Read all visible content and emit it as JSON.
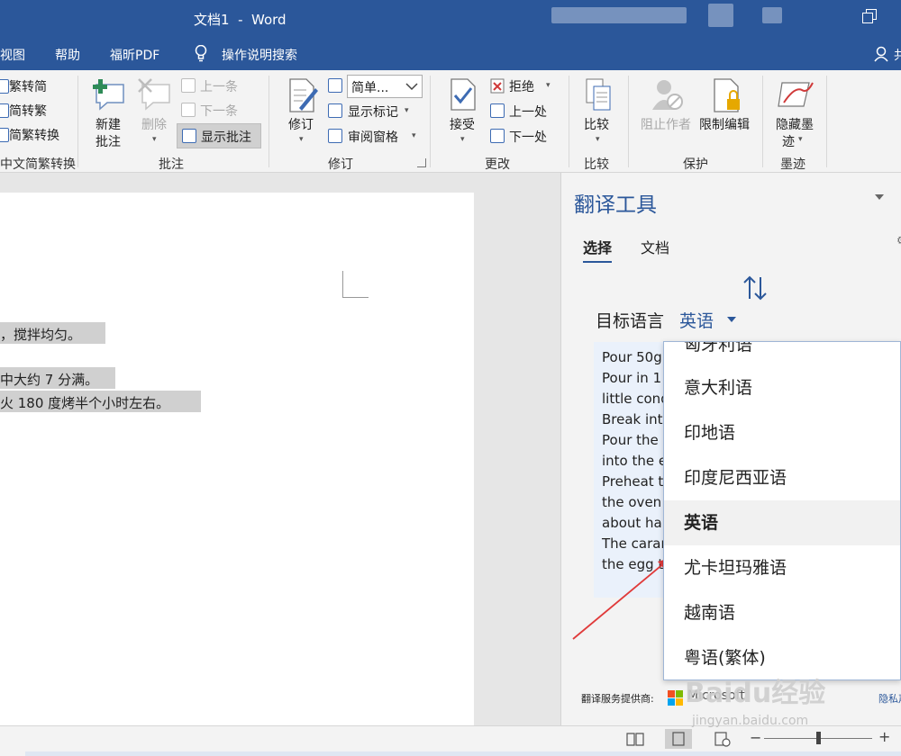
{
  "window": {
    "title": "文档1  -  Word"
  },
  "menu": {
    "items": [
      "视图",
      "帮助",
      "福昕PDF",
      "操作说明搜索"
    ],
    "user_initial": "共"
  },
  "ribbon": {
    "chinese_conversion": {
      "items": [
        "繁转简",
        "简转繁",
        "简繁转换"
      ],
      "group_label": "中文简繁转换"
    },
    "comments": {
      "new_comment": "新建批注",
      "new_comment_line1": "新建",
      "new_comment_line2": "批注",
      "delete": "删除",
      "previous": "上一条",
      "next": "下一条",
      "show_comments": "显示批注",
      "group_label": "批注"
    },
    "tracking": {
      "track_changes": "修订",
      "markup_combo": "简单...",
      "show_markup": "显示标记",
      "reviewing_pane": "审阅窗格",
      "group_label": "修订"
    },
    "changes": {
      "accept": "接受",
      "reject": "拒绝",
      "previous": "上一处",
      "next": "下一处",
      "group_label": "更改"
    },
    "compare": {
      "compare": "比较",
      "group_label": "比较"
    },
    "protect": {
      "block_authors": "阻止作者",
      "restrict_editing": "限制编辑",
      "group_label": "保护"
    },
    "ink": {
      "hide_ink_line1": "隐藏墨",
      "hide_ink_line2": "迹",
      "group_label": "墨迹"
    }
  },
  "document": {
    "lines": [
      "，搅拌均匀。",
      "中大约 7 分满。",
      "火 180 度烤半个小时左右。"
    ]
  },
  "translator": {
    "title": "翻译工具",
    "tabs": [
      "选择",
      "文档"
    ],
    "target_language_label": "目标语言",
    "target_language_value": "英语",
    "result_lines": [
      "Pour 50g",
      "Pour in 1",
      "little cond",
      "Break into",
      "Pour the",
      "into the e",
      "Preheat t",
      "the oven",
      "about ha",
      "The carar",
      "the egg t"
    ],
    "provider_label": "翻译服务提供商:",
    "provider_name": "Microsoft",
    "privacy_link": "隐私声"
  },
  "language_dropdown": {
    "items": [
      "匈牙利语",
      "意大利语",
      "印地语",
      "印度尼西亚语",
      "英语",
      "尤卡坦玛雅语",
      "越南语",
      "粤语(繁体)"
    ],
    "selected": "英语"
  },
  "watermark": {
    "text": "Baidu经验",
    "url": "jingyan.baidu.com"
  },
  "colors": {
    "word_blue": "#2b579a",
    "annotation_arrow": "#e03a3a",
    "selection_gray": "#d0d0d0"
  }
}
